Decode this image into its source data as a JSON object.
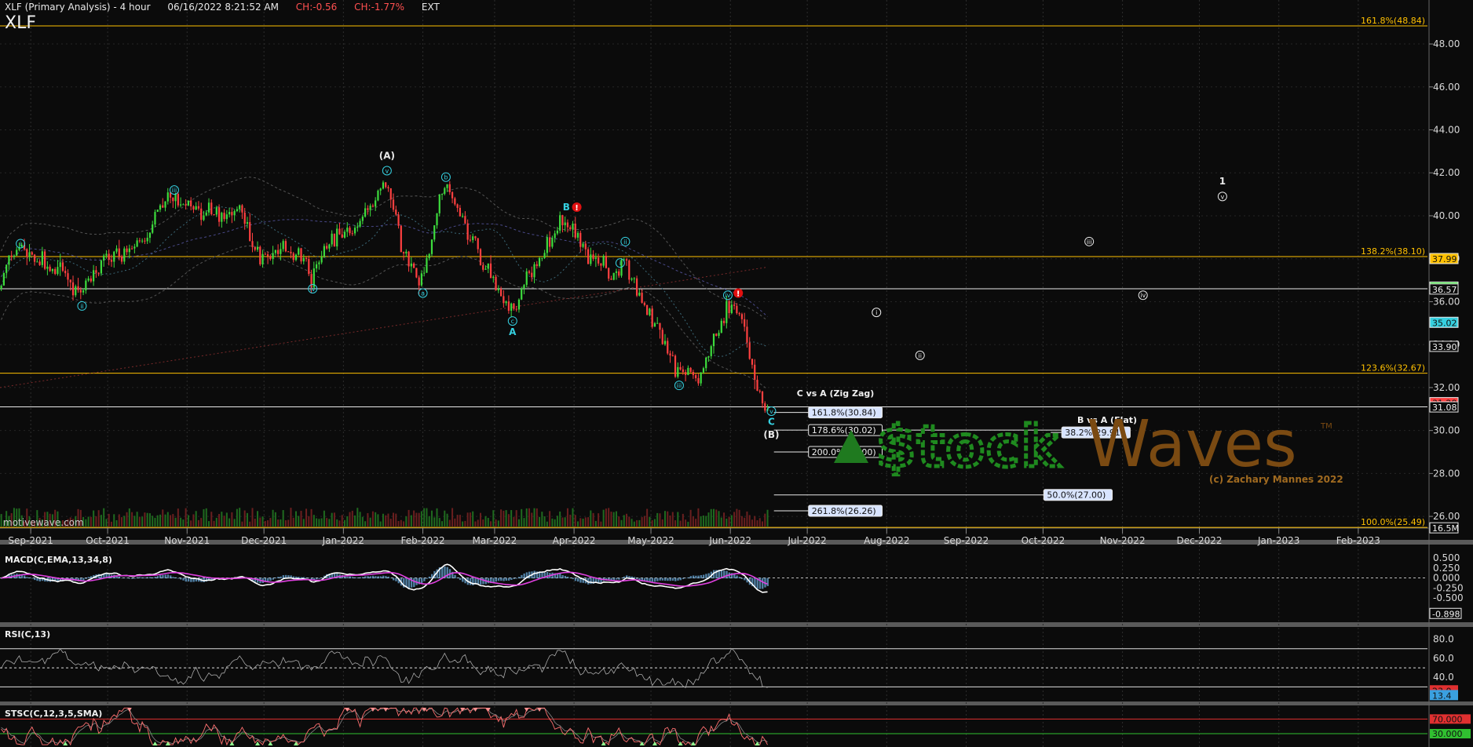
{
  "header": {
    "title": "XLF (Primary Analysis) - 4 hour",
    "datetime": "06/16/2022 8:21:52 AM",
    "change": "CH:-0.56",
    "change_pct": "CH:-1.77%",
    "session": "EXT",
    "symbol": "XLF",
    "watermark": "motivewave.com",
    "copyright": "(c) Zachary Mannes 2022",
    "logo_text": "StockWaves"
  },
  "colors": {
    "background": "#0b0b0b",
    "up": "#3ddc3d",
    "down": "#ff4040",
    "fib": "#ffc000",
    "wave": "#35d0e0",
    "white": "#e8e8e8"
  },
  "chart_data": [
    {
      "type": "candlestick",
      "title": "XLF (Primary Analysis) - 4 hour",
      "x_ticks": [
        "Sep-2021",
        "Oct-2021",
        "Nov-2021",
        "Dec-2021",
        "Jan-2022",
        "Feb-2022",
        "Mar-2022",
        "Apr-2022",
        "May-2022",
        "Jun-2022",
        "Jul-2022",
        "Aug-2022",
        "Sep-2022",
        "Oct-2022",
        "Nov-2022",
        "Dec-2022",
        "Jan-2023",
        "Feb-2023"
      ],
      "y_ticks": [
        "26.00",
        "28.00",
        "30.00",
        "32.00",
        "34.00",
        "36.00",
        "38.00",
        "40.00",
        "42.00",
        "44.00",
        "46.00",
        "48.00"
      ],
      "ylim": [
        25.2,
        49.5
      ],
      "price_path": [
        {
          "date": "2021-08-20",
          "price": 36.6
        },
        {
          "date": "2021-08-27",
          "price": 38.6
        },
        {
          "date": "2021-09-03",
          "price": 37.9
        },
        {
          "date": "2021-09-13",
          "price": 37.5
        },
        {
          "date": "2021-09-20",
          "price": 36.3
        },
        {
          "date": "2021-09-30",
          "price": 38.0
        },
        {
          "date": "2021-10-12",
          "price": 38.3
        },
        {
          "date": "2021-10-25",
          "price": 40.8
        },
        {
          "date": "2021-11-03",
          "price": 40.4
        },
        {
          "date": "2021-11-12",
          "price": 40.0
        },
        {
          "date": "2021-11-22",
          "price": 40.2
        },
        {
          "date": "2021-11-30",
          "price": 38.1
        },
        {
          "date": "2021-12-06",
          "price": 38.4
        },
        {
          "date": "2021-12-15",
          "price": 38.3
        },
        {
          "date": "2021-12-20",
          "price": 37.2
        },
        {
          "date": "2021-12-28",
          "price": 38.9
        },
        {
          "date": "2022-01-05",
          "price": 39.2
        },
        {
          "date": "2022-01-18",
          "price": 41.6
        },
        {
          "date": "2022-01-25",
          "price": 38.4
        },
        {
          "date": "2022-02-01",
          "price": 37.0
        },
        {
          "date": "2022-02-10",
          "price": 41.5
        },
        {
          "date": "2022-02-18",
          "price": 39.4
        },
        {
          "date": "2022-02-24",
          "price": 37.9
        },
        {
          "date": "2022-03-08",
          "price": 35.6
        },
        {
          "date": "2022-03-14",
          "price": 37.0
        },
        {
          "date": "2022-03-29",
          "price": 40.0
        },
        {
          "date": "2022-04-07",
          "price": 38.2
        },
        {
          "date": "2022-04-18",
          "price": 37.3
        },
        {
          "date": "2022-04-21",
          "price": 38.0
        },
        {
          "date": "2022-05-02",
          "price": 35.2
        },
        {
          "date": "2022-05-12",
          "price": 32.6
        },
        {
          "date": "2022-05-20",
          "price": 32.5
        },
        {
          "date": "2022-05-31",
          "price": 35.8
        },
        {
          "date": "2022-06-06",
          "price": 35.4
        },
        {
          "date": "2022-06-09",
          "price": 33.5
        },
        {
          "date": "2022-06-13",
          "price": 31.7
        },
        {
          "date": "2022-06-16",
          "price": 31.1
        }
      ],
      "fib_levels": [
        {
          "label": "161.8%(48.84)",
          "value": 48.84
        },
        {
          "label": "138.2%(38.10)",
          "value": 38.1
        },
        {
          "label": "123.6%(32.67)",
          "value": 32.67
        },
        {
          "label": "100.0%(25.49)",
          "value": 25.49
        }
      ],
      "horizontal_lines_white": [
        36.6,
        31.1
      ],
      "price_tags": [
        {
          "label": "37.99",
          "value": 37.99,
          "color": "#ffc000"
        },
        {
          "label": "36.66",
          "value": 36.66,
          "color": "#3ddc3d"
        },
        {
          "label": "36.57",
          "value": 36.57,
          "color": "#e8e8e8"
        },
        {
          "label": "35.02",
          "value": 35.02,
          "color": "#35d0e0"
        },
        {
          "label": "33.90",
          "value": 33.9,
          "color": "#e8e8e8"
        },
        {
          "label": "31.28",
          "value": 31.28,
          "color": "#ff4040"
        },
        {
          "label": "31.08",
          "value": 31.08,
          "color": "#e8e8e8"
        },
        {
          "label": "16.5M",
          "value": 25.45,
          "color": "#e8e8e8"
        }
      ],
      "wave_labels": [
        {
          "label": "i",
          "date": "2021-08-28",
          "price": 38.7,
          "color": "#35d0e0",
          "circle": true
        },
        {
          "label": "ii",
          "date": "2021-09-21",
          "price": 35.8,
          "color": "#35d0e0",
          "circle": true
        },
        {
          "label": "iii",
          "date": "2021-10-27",
          "price": 41.2,
          "color": "#35d0e0",
          "circle": true
        },
        {
          "label": "iv",
          "date": "2021-12-20",
          "price": 36.6,
          "color": "#35d0e0",
          "circle": true
        },
        {
          "label": "v",
          "date": "2022-01-18",
          "price": 42.1,
          "color": "#35d0e0",
          "circle": true
        },
        {
          "label": "(A)",
          "date": "2022-01-18",
          "price": 42.8,
          "color": "#e8e8e8",
          "circle": false
        },
        {
          "label": "a",
          "date": "2022-02-01",
          "price": 36.4,
          "color": "#35d0e0",
          "circle": true
        },
        {
          "label": "b",
          "date": "2022-02-10",
          "price": 41.8,
          "color": "#35d0e0",
          "circle": true
        },
        {
          "label": "c",
          "date": "2022-03-08",
          "price": 35.1,
          "color": "#35d0e0",
          "circle": true
        },
        {
          "label": "A",
          "date": "2022-03-08",
          "price": 34.6,
          "color": "#35d0e0",
          "circle": false
        },
        {
          "label": "B",
          "date": "2022-03-29",
          "price": 40.4,
          "color": "#35d0e0",
          "circle": false
        },
        {
          "label": "i",
          "date": "2022-04-19",
          "price": 37.8,
          "color": "#35d0e0",
          "circle": true
        },
        {
          "label": "ii",
          "date": "2022-04-21",
          "price": 38.8,
          "color": "#35d0e0",
          "circle": true
        },
        {
          "label": "iii",
          "date": "2022-05-12",
          "price": 32.1,
          "color": "#35d0e0",
          "circle": true
        },
        {
          "label": "iv",
          "date": "2022-05-31",
          "price": 36.3,
          "color": "#35d0e0",
          "circle": true
        },
        {
          "label": "v",
          "date": "2022-06-17",
          "price": 30.9,
          "color": "#35d0e0",
          "circle": true
        },
        {
          "label": "C",
          "date": "2022-06-17",
          "price": 30.4,
          "color": "#35d0e0",
          "circle": false
        },
        {
          "label": "(B)",
          "date": "2022-06-17",
          "price": 29.8,
          "color": "#e8e8e8",
          "circle": false
        },
        {
          "label": "i",
          "date": "2022-07-28",
          "price": 35.5,
          "color": "#e8e8e8",
          "circle": true
        },
        {
          "label": "ii",
          "date": "2022-08-14",
          "price": 33.5,
          "color": "#e8e8e8",
          "circle": true
        },
        {
          "label": "iii",
          "date": "2022-10-19",
          "price": 38.8,
          "color": "#e8e8e8",
          "circle": true
        },
        {
          "label": "iv",
          "date": "2022-11-09",
          "price": 36.3,
          "color": "#e8e8e8",
          "circle": true
        },
        {
          "label": "v",
          "date": "2022-12-10",
          "price": 40.9,
          "color": "#e8e8e8",
          "circle": true
        },
        {
          "label": "1",
          "date": "2022-12-10",
          "price": 41.6,
          "color": "#e8e8e8",
          "circle": false
        }
      ],
      "annotations": [
        {
          "text": "C vs A (Zig Zag)",
          "date": "2022-07-12",
          "price": 31.75
        },
        {
          "text": "B vs A (Flat)",
          "date": "2022-10-26",
          "price": 30.5
        }
      ],
      "projection_boxes": [
        {
          "label": "161.8%(30.84)",
          "price": 30.84,
          "start": "2022-06-18",
          "end": "2022-07-10"
        },
        {
          "label": "178.6%(30.02)",
          "price": 30.02,
          "start": "2022-06-18",
          "end": "2022-10-28"
        },
        {
          "label": "200.0%(29.00)",
          "price": 29.0,
          "start": "2022-06-18",
          "end": "2022-07-10"
        },
        {
          "label": "50.0%(27.00)",
          "price": 27.0,
          "start": "2022-06-18",
          "end": "2022-10-28"
        },
        {
          "label": "261.8%(26.26)",
          "price": 26.26,
          "start": "2022-06-18",
          "end": "2022-07-10"
        },
        {
          "label": "38.2%(29.91)",
          "price": 29.91,
          "start": "2022-10-04",
          "end": "2022-10-28"
        }
      ]
    },
    {
      "type": "line",
      "name": "MACD(C,EMA,13,34,8)",
      "y_ticks": [
        "0.500",
        "0.250",
        "0.000",
        "-0.250",
        "-0.500"
      ],
      "ylim": [
        -1.05,
        0.62
      ],
      "last_value": "-0.898"
    },
    {
      "type": "line",
      "name": "RSI(C,13)",
      "y_ticks": [
        "80.0",
        "60.0",
        "40.0"
      ],
      "levels": [
        70,
        50,
        30
      ],
      "ylim": [
        18,
        92
      ],
      "last_values": [
        "23.0",
        "13.4"
      ]
    },
    {
      "type": "line",
      "name": "STSC(C,12,3,5,SMA)",
      "y_ticks": [
        "70.000",
        "30.000"
      ],
      "levels": [
        70,
        30
      ],
      "ylim": [
        -2,
        105
      ]
    }
  ]
}
